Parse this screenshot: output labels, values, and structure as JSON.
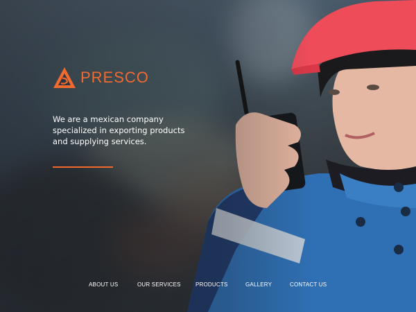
{
  "brand": {
    "name": "PRESCO",
    "logo_icon": "presco-triangle-logo-icon",
    "accent_color": "#f26a2e"
  },
  "hero": {
    "tagline": "We are a mexican company specialized in exporting products and supplying services.",
    "image": "woman-in-red-hard-hat-with-walkie-talkie"
  },
  "nav": {
    "items": [
      {
        "label": "ABOUT US"
      },
      {
        "label": "OUR SERVICES"
      },
      {
        "label": "PRODUCTS"
      },
      {
        "label": "GALLERY"
      },
      {
        "label": "CONTACT US"
      }
    ]
  }
}
